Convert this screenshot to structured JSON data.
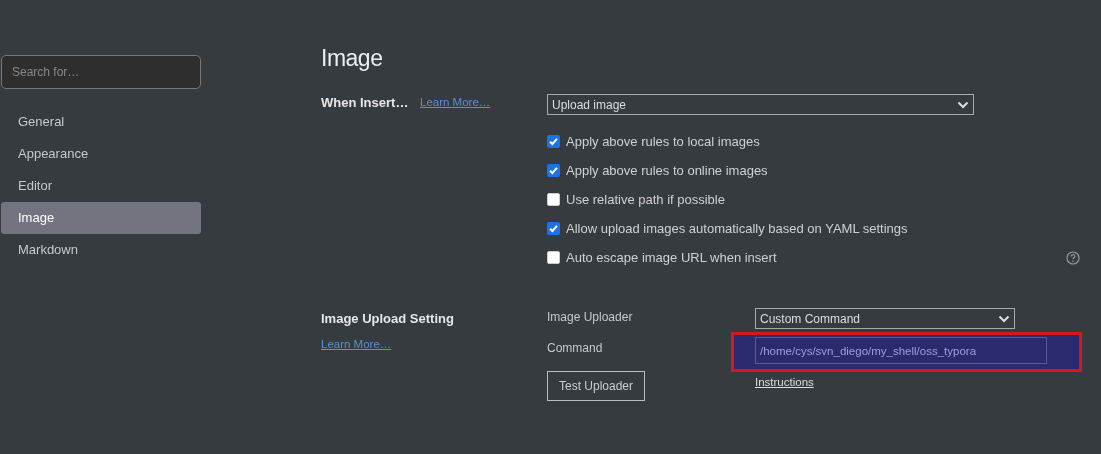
{
  "sidebar": {
    "search": {
      "placeholder": "Search for…"
    },
    "items": [
      {
        "label": "General",
        "selected": false
      },
      {
        "label": "Appearance",
        "selected": false
      },
      {
        "label": "Editor",
        "selected": false
      },
      {
        "label": "Image",
        "selected": true
      },
      {
        "label": "Markdown",
        "selected": false
      }
    ]
  },
  "page_title": "Image",
  "when_insert": {
    "label": "When Insert…",
    "link": "Learn More…",
    "dropdown": "Upload image",
    "options": [
      {
        "label": "Apply above rules to local images",
        "checked": true
      },
      {
        "label": "Apply above rules to online images",
        "checked": true
      },
      {
        "label": "Use relative path if possible",
        "checked": false
      },
      {
        "label": "Allow upload images automatically based on YAML settings",
        "checked": true
      },
      {
        "label": "Auto escape image URL when insert",
        "checked": false
      }
    ]
  },
  "upload_setting": {
    "label": "Image Upload Setting",
    "link": "Learn More…",
    "uploader_label": "Image Uploader",
    "uploader": "Custom Command",
    "command_label": "Command",
    "command": "/home/cys/svn_diego/my_shell/oss_typora",
    "command_highlighted": true,
    "instructions": "Instructions",
    "test_button": "Test Uploader"
  }
}
